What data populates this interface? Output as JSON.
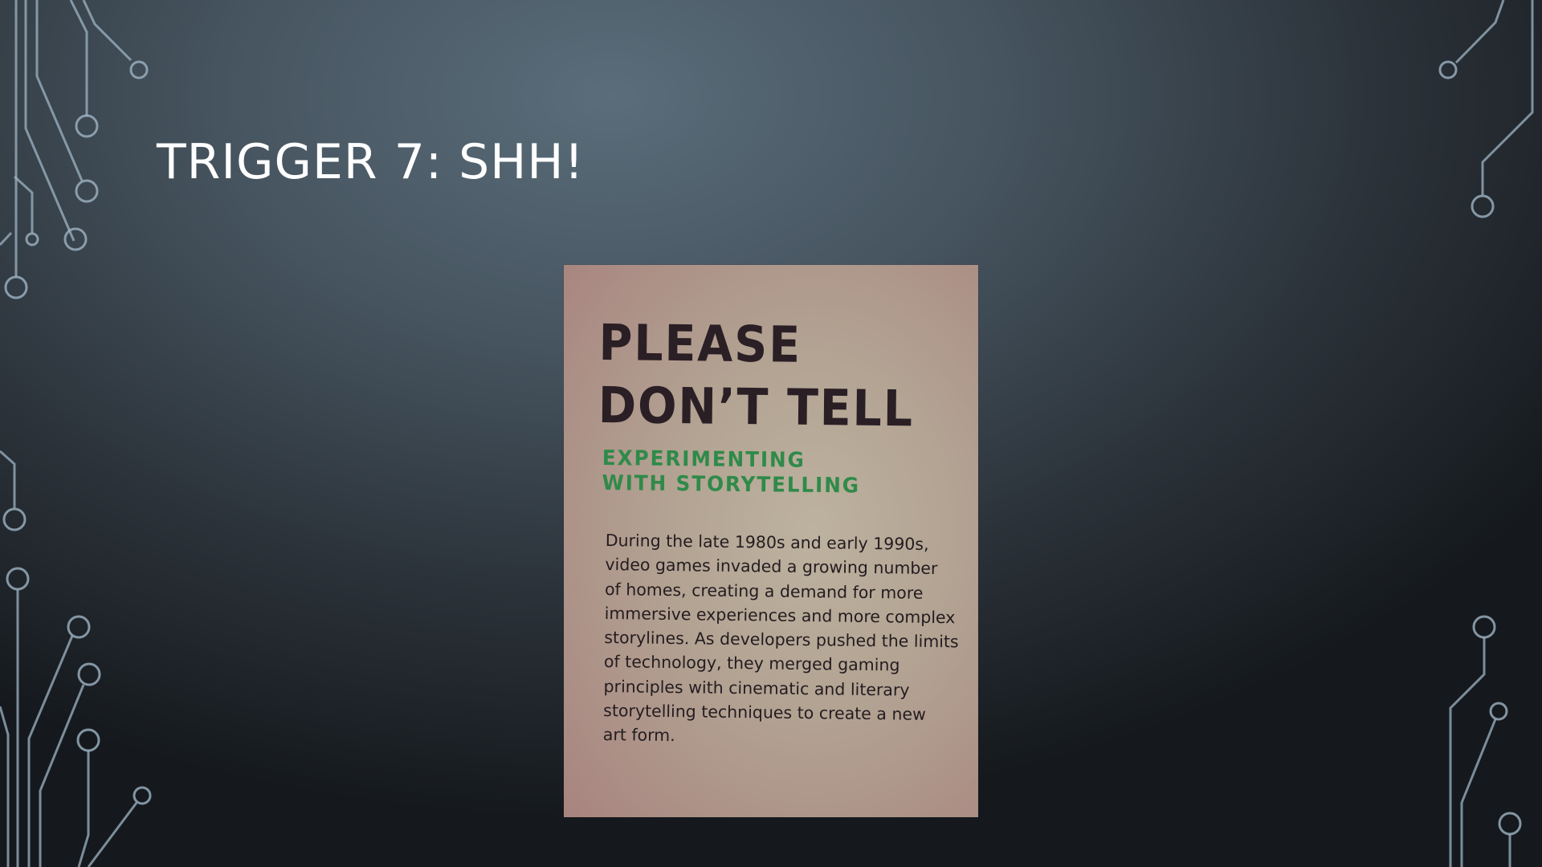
{
  "slide": {
    "title": "TRIGGER 7: SHH!"
  },
  "photo": {
    "heading_lines": [
      "PLEASE",
      "DON’T TELL"
    ],
    "subheading_lines": [
      "EXPERIMENTING",
      "WITH STORYTELLING"
    ],
    "body_lines": [
      "During the late 1980s and early 1990s,",
      "video games invaded a growing number",
      "of homes, creating a demand for more",
      "immersive experiences and more complex",
      "storylines. As developers pushed the limits",
      "of technology, they merged gaming",
      "principles with cinematic and literary",
      "storytelling techniques to create a new",
      "art form."
    ]
  },
  "colors": {
    "background_light": "#5a6d7a",
    "background_dark": "#15191d",
    "circuit_line": "#9fb4c4",
    "title_text": "#ffffff",
    "placard_background": "#b2a292",
    "heading_text": "#2a1f25",
    "subheading_text": "#2f8a49",
    "body_text": "#231c20"
  }
}
